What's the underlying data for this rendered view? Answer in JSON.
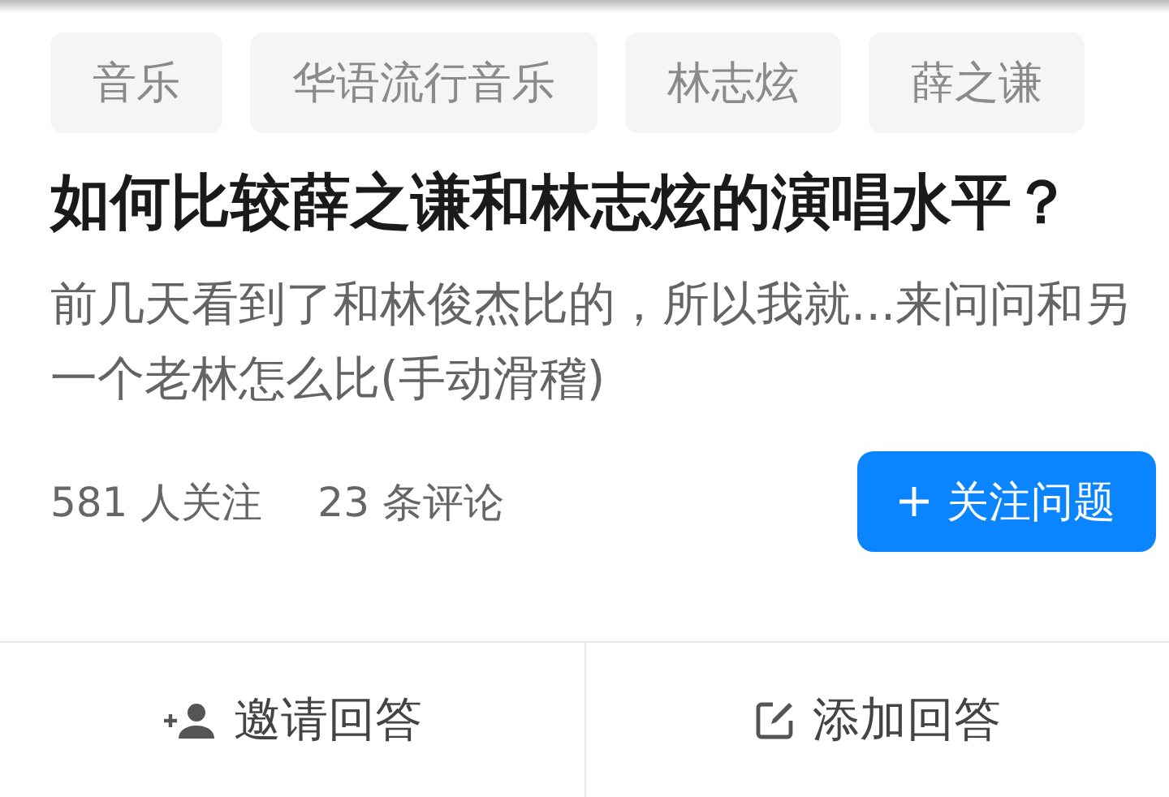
{
  "tags": [
    {
      "label": "音乐"
    },
    {
      "label": "华语流行音乐"
    },
    {
      "label": "林志炫"
    },
    {
      "label": "薛之谦"
    }
  ],
  "question": {
    "title": "如何比较薛之谦和林志炫的演唱水平？",
    "description": "前几天看到了和林俊杰比的，所以我就...来问问和另一个老林怎么比(手动滑稽)"
  },
  "stats": [
    {
      "label": "581 人关注"
    },
    {
      "label": "23 条评论"
    }
  ],
  "follow_button": {
    "label": "关注问题"
  },
  "actions": [
    {
      "kind": "invite",
      "label": "邀请回答"
    },
    {
      "kind": "answer",
      "label": "添加回答"
    }
  ]
}
